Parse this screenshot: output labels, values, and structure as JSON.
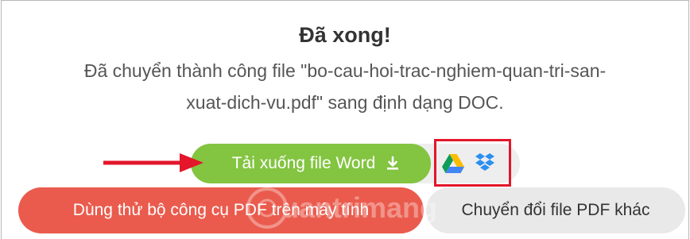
{
  "result": {
    "title": "Đã xong!",
    "message_line1": "Đã chuyển thành công file \"bo-cau-hoi-trac-nghiem-quan-tri-san-",
    "message_line2": "xuat-dich-vu.pdf\" sang định dạng DOC."
  },
  "actions": {
    "download_label": "Tải xuống file Word",
    "download_icon": "download-icon",
    "cloud_targets": [
      "google-drive-icon",
      "dropbox-icon"
    ],
    "try_desktop_label": "Dùng thử bộ công cụ PDF trên máy tính",
    "convert_other_label": "Chuyển đổi file PDF khác"
  },
  "watermark": {
    "text": "Quantrimang"
  },
  "colors": {
    "download_green": "#83c441",
    "try_red": "#ea5b4d",
    "highlight_red": "#e3162a",
    "secondary_gray": "#e9e9e9"
  }
}
